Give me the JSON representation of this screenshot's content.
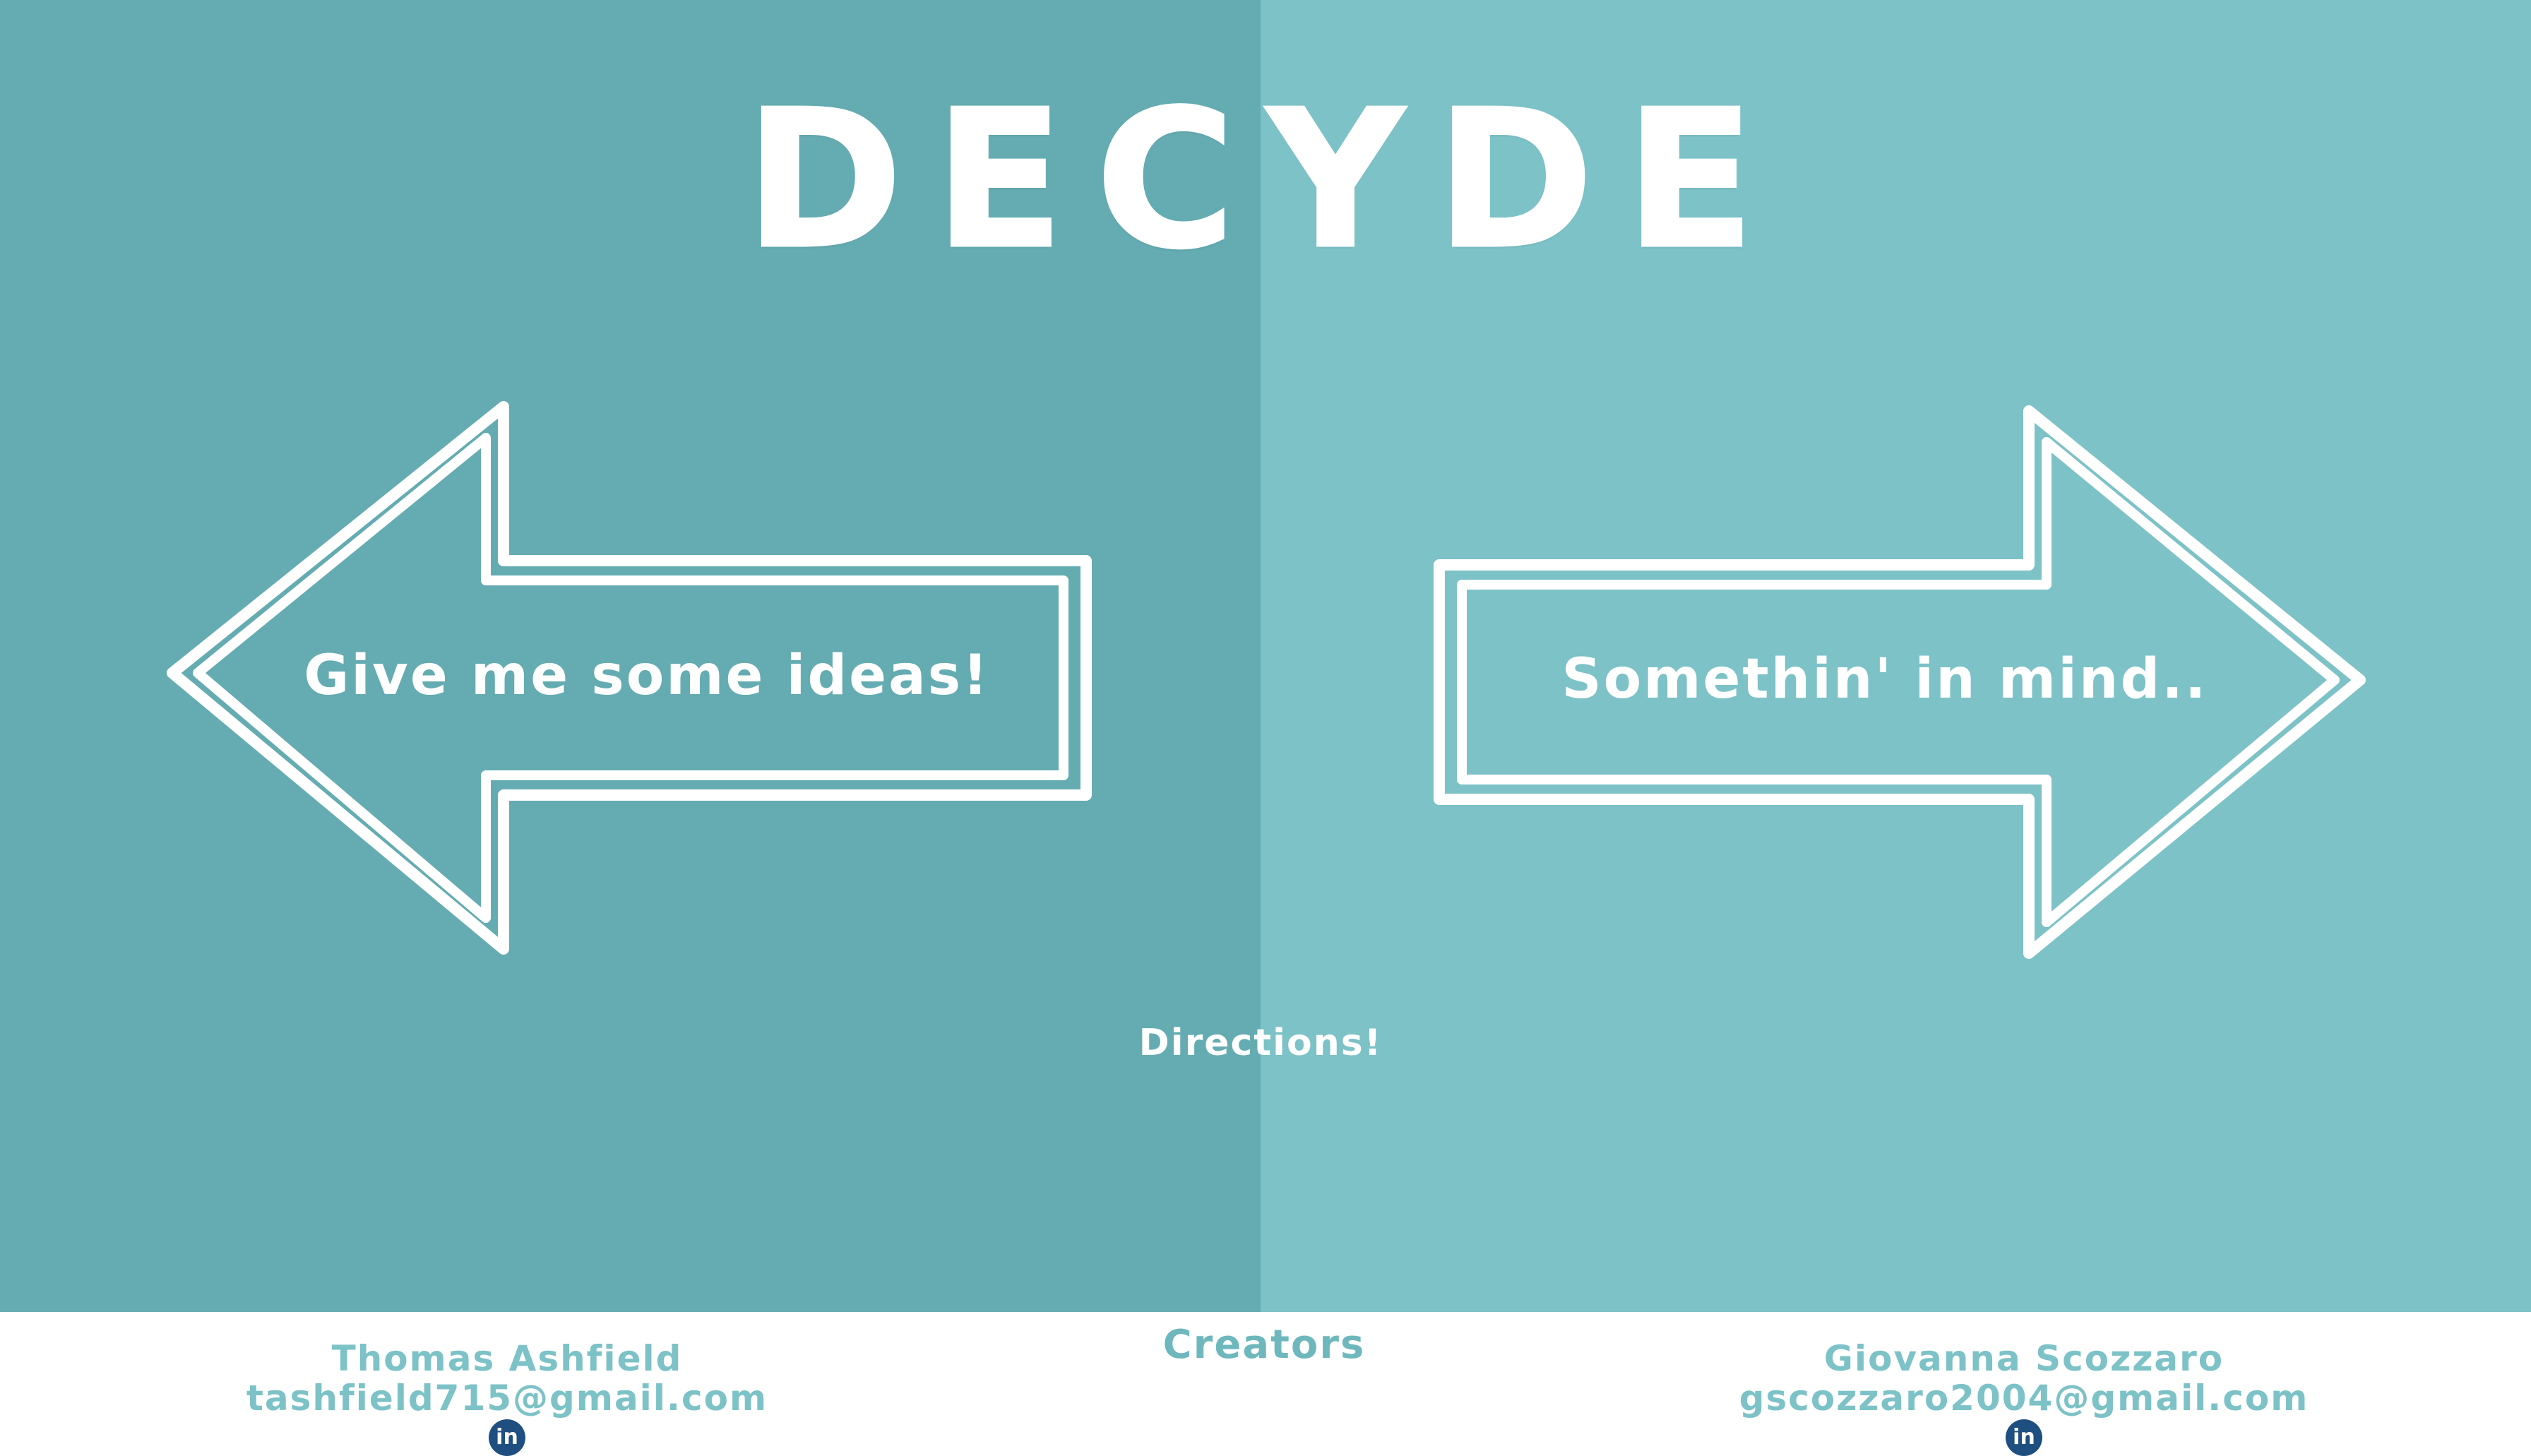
{
  "site": {
    "title": "DECYDE"
  },
  "arrows": {
    "left_label": "Give me some ideas!",
    "right_label": "Somethin' in mind.."
  },
  "directions_label": "Directions!",
  "footer": {
    "heading": "Creators",
    "creators": [
      {
        "name": "Thomas Ashfield",
        "email": "tashfield715@gmail.com",
        "link_icon": "linkedin-icon",
        "link_text": "in"
      },
      {
        "name": "Giovanna Scozzaro",
        "email": "gscozzaro2004@gmail.com",
        "link_icon": "linkedin-icon",
        "link_text": "in"
      }
    ]
  },
  "colors": {
    "left_panel": "#64acb1",
    "right_panel": "#7cc2c7",
    "footer_text": "#7cc2c7",
    "linkedin_badge": "#1f4f80",
    "white": "#ffffff"
  }
}
